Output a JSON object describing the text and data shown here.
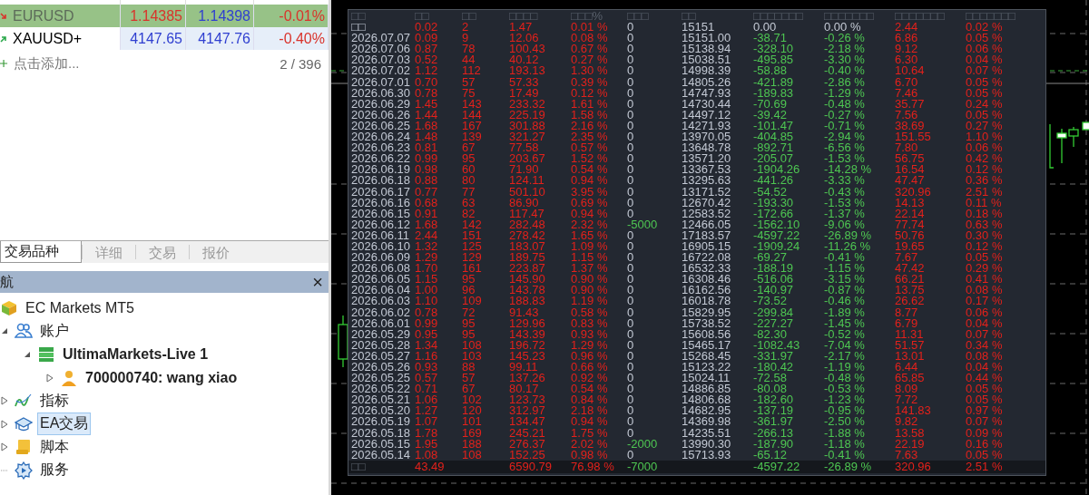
{
  "market_watch": {
    "rows": [
      {
        "symbol": "EURUSD",
        "bid": "1.14385",
        "ask": "1.14398",
        "change": "-0.01%",
        "rising": false,
        "selected": true,
        "bid_rising": false,
        "ask_rising": true
      },
      {
        "symbol": "XAUUSD+",
        "bid": "4147.65",
        "ask": "4147.76",
        "change": "-0.40%",
        "rising": true,
        "selected": false,
        "bid_rising": true,
        "ask_rising": true
      }
    ],
    "add_label": "点击添加...",
    "count": "2 / 396"
  },
  "tabs": [
    {
      "label": "交易品种",
      "selected": true
    },
    {
      "label": "详细",
      "selected": false
    },
    {
      "label": "交易",
      "selected": false
    },
    {
      "label": "报价",
      "selected": false
    }
  ],
  "navigator": {
    "title": "航",
    "close": "×",
    "tree": [
      {
        "label": "EC Markets MT5",
        "kind": "root",
        "children": [
          {
            "label": "账户",
            "kind": "accounts",
            "expanded": true,
            "children": [
              {
                "label": "UltimaMarkets-Live 1",
                "kind": "server",
                "expanded": true,
                "children": [
                  {
                    "label": "700000740: wang xiao",
                    "kind": "user",
                    "expanded": false
                  }
                ]
              }
            ]
          },
          {
            "label": "指标",
            "kind": "indicators",
            "expanded": false
          },
          {
            "label": "EA交易",
            "kind": "experts",
            "expanded": false,
            "selected": true
          },
          {
            "label": "脚本",
            "kind": "scripts",
            "expanded": false
          },
          {
            "label": "服务",
            "kind": "services"
          }
        ]
      }
    ]
  },
  "stats": {
    "header": [
      "□□",
      "□□",
      "□□",
      "□□□□",
      "□□□%",
      "□□□",
      "□□",
      "□□□□□□□",
      "□□□□□□□",
      "□□□□□□□",
      "□□□□□□□"
    ],
    "rows": [
      {
        "cells": [
          "□□",
          "0.02",
          "2",
          "1.47",
          "0.01 %",
          "0",
          "15151",
          "0.00",
          "0.00 %",
          "2.44",
          "0.02 %"
        ],
        "withdrawal": false,
        "baseline": true
      },
      {
        "cells": [
          "2026.07.07",
          "0.09",
          "9",
          "12.06",
          "0.08 %",
          "0",
          "15151.00",
          "-38.71",
          "-0.26 %",
          "6.86",
          "0.05 %"
        ],
        "withdrawal": false,
        "baseline": false
      },
      {
        "cells": [
          "2026.07.06",
          "0.87",
          "78",
          "100.43",
          "0.67 %",
          "0",
          "15138.94",
          "-328.10",
          "-2.18 %",
          "9.12",
          "0.06 %"
        ],
        "withdrawal": false,
        "baseline": false
      },
      {
        "cells": [
          "2026.07.03",
          "0.52",
          "44",
          "40.12",
          "0.27 %",
          "0",
          "15038.51",
          "-495.85",
          "-3.30 %",
          "6.30",
          "0.04 %"
        ],
        "withdrawal": false,
        "baseline": false
      },
      {
        "cells": [
          "2026.07.02",
          "1.12",
          "112",
          "193.13",
          "1.30 %",
          "0",
          "14998.39",
          "-58.88",
          "-0.40 %",
          "10.64",
          "0.07 %"
        ],
        "withdrawal": false,
        "baseline": false
      },
      {
        "cells": [
          "2026.07.01",
          "0.70",
          "57",
          "57.33",
          "0.39 %",
          "0",
          "14805.26",
          "-421.89",
          "-2.86 %",
          "6.70",
          "0.05 %"
        ],
        "withdrawal": false,
        "baseline": false
      },
      {
        "cells": [
          "2026.06.30",
          "0.78",
          "75",
          "17.49",
          "0.12 %",
          "0",
          "14747.93",
          "-189.83",
          "-1.29 %",
          "7.46",
          "0.05 %"
        ],
        "withdrawal": false,
        "baseline": false
      },
      {
        "cells": [
          "2026.06.29",
          "1.45",
          "143",
          "233.32",
          "1.61 %",
          "0",
          "14730.44",
          "-70.69",
          "-0.48 %",
          "35.77",
          "0.24 %"
        ],
        "withdrawal": false,
        "baseline": false
      },
      {
        "cells": [
          "2026.06.26",
          "1.44",
          "144",
          "225.19",
          "1.58 %",
          "0",
          "14497.12",
          "-39.42",
          "-0.27 %",
          "7.56",
          "0.05 %"
        ],
        "withdrawal": false,
        "baseline": false
      },
      {
        "cells": [
          "2026.06.25",
          "1.68",
          "167",
          "301.88",
          "2.16 %",
          "0",
          "14271.93",
          "-101.47",
          "-0.71 %",
          "38.69",
          "0.27 %"
        ],
        "withdrawal": false,
        "baseline": false
      },
      {
        "cells": [
          "2026.06.24",
          "1.48",
          "139",
          "321.27",
          "2.35 %",
          "0",
          "13970.05",
          "-404.85",
          "-2.94 %",
          "151.55",
          "1.10 %"
        ],
        "withdrawal": false,
        "baseline": false
      },
      {
        "cells": [
          "2026.06.23",
          "0.81",
          "67",
          "77.58",
          "0.57 %",
          "0",
          "13648.78",
          "-892.71",
          "-6.56 %",
          "7.80",
          "0.06 %"
        ],
        "withdrawal": false,
        "baseline": false
      },
      {
        "cells": [
          "2026.06.22",
          "0.99",
          "95",
          "203.67",
          "1.52 %",
          "0",
          "13571.20",
          "-205.07",
          "-1.53 %",
          "56.75",
          "0.42 %"
        ],
        "withdrawal": false,
        "baseline": false
      },
      {
        "cells": [
          "2026.06.19",
          "0.98",
          "60",
          "71.90",
          "0.54 %",
          "0",
          "13367.53",
          "-1904.26",
          "-14.28 %",
          "16.54",
          "0.12 %"
        ],
        "withdrawal": false,
        "baseline": false
      },
      {
        "cells": [
          "2026.06.18",
          "0.88",
          "80",
          "124.11",
          "0.94 %",
          "0",
          "13295.63",
          "-441.26",
          "-3.33 %",
          "47.47",
          "0.36 %"
        ],
        "withdrawal": false,
        "baseline": false
      },
      {
        "cells": [
          "2026.06.17",
          "0.77",
          "77",
          "501.10",
          "3.95 %",
          "0",
          "13171.52",
          "-54.52",
          "-0.43 %",
          "320.96",
          "2.51 %"
        ],
        "withdrawal": false,
        "baseline": false
      },
      {
        "cells": [
          "2026.06.16",
          "0.68",
          "63",
          "86.90",
          "0.69 %",
          "0",
          "12670.42",
          "-193.30",
          "-1.53 %",
          "14.13",
          "0.11 %"
        ],
        "withdrawal": false,
        "baseline": false
      },
      {
        "cells": [
          "2026.06.15",
          "0.91",
          "82",
          "117.47",
          "0.94 %",
          "0",
          "12583.52",
          "-172.66",
          "-1.37 %",
          "22.14",
          "0.18 %"
        ],
        "withdrawal": false,
        "baseline": false
      },
      {
        "cells": [
          "2026.06.12",
          "1.68",
          "142",
          "282.48",
          "2.32 %",
          "-5000",
          "12466.05",
          "-1562.10",
          "-9.06 %",
          "77.74",
          "0.63 %"
        ],
        "withdrawal": true,
        "baseline": false
      },
      {
        "cells": [
          "2026.06.11",
          "2.44",
          "151",
          "278.42",
          "1.65 %",
          "0",
          "17183.57",
          "-4597.22",
          "-26.89 %",
          "50.76",
          "0.30 %"
        ],
        "withdrawal": false,
        "baseline": false
      },
      {
        "cells": [
          "2026.06.10",
          "1.32",
          "125",
          "183.07",
          "1.09 %",
          "0",
          "16905.15",
          "-1909.24",
          "-11.26 %",
          "19.65",
          "0.12 %"
        ],
        "withdrawal": false,
        "baseline": false
      },
      {
        "cells": [
          "2026.06.09",
          "1.29",
          "129",
          "189.75",
          "1.15 %",
          "0",
          "16722.08",
          "-69.27",
          "-0.41 %",
          "7.67",
          "0.05 %"
        ],
        "withdrawal": false,
        "baseline": false
      },
      {
        "cells": [
          "2026.06.08",
          "1.70",
          "161",
          "223.87",
          "1.37 %",
          "0",
          "16532.33",
          "-188.19",
          "-1.15 %",
          "47.42",
          "0.29 %"
        ],
        "withdrawal": false,
        "baseline": false
      },
      {
        "cells": [
          "2026.06.05",
          "1.15",
          "95",
          "145.90",
          "0.90 %",
          "0",
          "16308.46",
          "-516.06",
          "-3.15 %",
          "66.21",
          "0.41 %"
        ],
        "withdrawal": false,
        "baseline": false
      },
      {
        "cells": [
          "2026.06.04",
          "1.00",
          "96",
          "143.78",
          "0.90 %",
          "0",
          "16162.56",
          "-140.97",
          "-0.87 %",
          "13.75",
          "0.08 %"
        ],
        "withdrawal": false,
        "baseline": false
      },
      {
        "cells": [
          "2026.06.03",
          "1.10",
          "109",
          "188.83",
          "1.19 %",
          "0",
          "16018.78",
          "-73.52",
          "-0.46 %",
          "26.62",
          "0.17 %"
        ],
        "withdrawal": false,
        "baseline": false
      },
      {
        "cells": [
          "2026.06.02",
          "0.78",
          "72",
          "91.43",
          "0.58 %",
          "0",
          "15829.95",
          "-299.84",
          "-1.89 %",
          "8.77",
          "0.06 %"
        ],
        "withdrawal": false,
        "baseline": false
      },
      {
        "cells": [
          "2026.06.01",
          "0.99",
          "95",
          "129.96",
          "0.83 %",
          "0",
          "15738.52",
          "-227.27",
          "-1.45 %",
          "6.79",
          "0.04 %"
        ],
        "withdrawal": false,
        "baseline": false
      },
      {
        "cells": [
          "2026.05.29",
          "0.95",
          "95",
          "143.39",
          "0.93 %",
          "0",
          "15608.56",
          "-82.30",
          "-0.52 %",
          "11.31",
          "0.07 %"
        ],
        "withdrawal": false,
        "baseline": false
      },
      {
        "cells": [
          "2026.05.28",
          "1.34",
          "108",
          "196.72",
          "1.29 %",
          "0",
          "15465.17",
          "-1082.43",
          "-7.04 %",
          "51.57",
          "0.34 %"
        ],
        "withdrawal": false,
        "baseline": false
      },
      {
        "cells": [
          "2026.05.27",
          "1.16",
          "103",
          "145.23",
          "0.96 %",
          "0",
          "15268.45",
          "-331.97",
          "-2.17 %",
          "13.01",
          "0.08 %"
        ],
        "withdrawal": false,
        "baseline": false
      },
      {
        "cells": [
          "2026.05.26",
          "0.93",
          "88",
          "99.11",
          "0.66 %",
          "0",
          "15123.22",
          "-180.42",
          "-1.19 %",
          "6.44",
          "0.04 %"
        ],
        "withdrawal": false,
        "baseline": false
      },
      {
        "cells": [
          "2026.05.25",
          "0.57",
          "57",
          "137.26",
          "0.92 %",
          "0",
          "15024.11",
          "-72.58",
          "-0.48 %",
          "65.85",
          "0.44 %"
        ],
        "withdrawal": false,
        "baseline": false
      },
      {
        "cells": [
          "2026.05.22",
          "0.71",
          "67",
          "80.17",
          "0.54 %",
          "0",
          "14886.85",
          "-80.08",
          "-0.53 %",
          "8.09",
          "0.05 %"
        ],
        "withdrawal": false,
        "baseline": false
      },
      {
        "cells": [
          "2026.05.21",
          "1.06",
          "102",
          "123.73",
          "0.84 %",
          "0",
          "14806.68",
          "-182.60",
          "-1.23 %",
          "7.72",
          "0.05 %"
        ],
        "withdrawal": false,
        "baseline": false
      },
      {
        "cells": [
          "2026.05.20",
          "1.27",
          "120",
          "312.97",
          "2.18 %",
          "0",
          "14682.95",
          "-137.19",
          "-0.95 %",
          "141.83",
          "0.97 %"
        ],
        "withdrawal": false,
        "baseline": false
      },
      {
        "cells": [
          "2026.05.19",
          "1.07",
          "101",
          "134.47",
          "0.94 %",
          "0",
          "14369.98",
          "-361.97",
          "-2.50 %",
          "9.82",
          "0.07 %"
        ],
        "withdrawal": false,
        "baseline": false
      },
      {
        "cells": [
          "2026.05.18",
          "1.78",
          "169",
          "245.21",
          "1.75 %",
          "0",
          "14235.51",
          "-266.13",
          "-1.88 %",
          "13.58",
          "0.09 %"
        ],
        "withdrawal": false,
        "baseline": false
      },
      {
        "cells": [
          "2026.05.15",
          "1.95",
          "188",
          "276.37",
          "2.02 %",
          "-2000",
          "13990.30",
          "-187.90",
          "-1.18 %",
          "22.19",
          "0.16 %"
        ],
        "withdrawal": true,
        "baseline": false
      },
      {
        "cells": [
          "2026.05.14",
          "1.08",
          "108",
          "152.25",
          "0.98 %",
          "0",
          "15713.93",
          "-65.12",
          "-0.41 %",
          "7.63",
          "0.05 %"
        ],
        "withdrawal": false,
        "baseline": false
      }
    ],
    "total": {
      "cells": [
        "□□",
        "43.49",
        null,
        "6590.79",
        "76.98 %",
        "-7000",
        null,
        "-4597.22",
        "-26.89 %",
        "320.96",
        "2.51 %"
      ],
      "withdrawal": true,
      "baseline": false
    }
  }
}
